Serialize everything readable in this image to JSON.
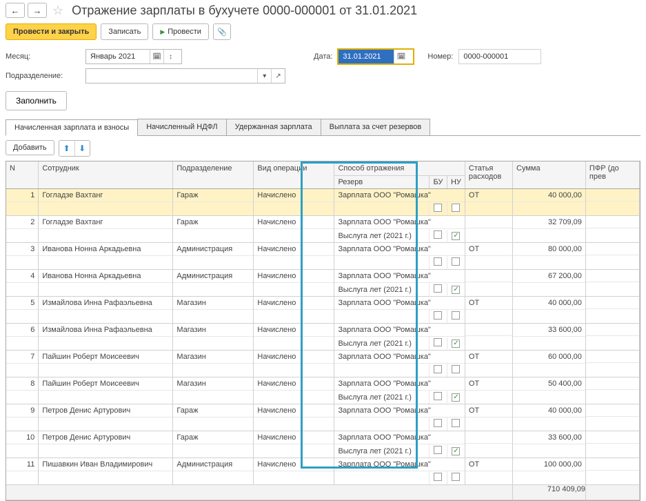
{
  "header": {
    "title": "Отражение зарплаты в бухучете 0000-000001 от 31.01.2021"
  },
  "toolbar": {
    "post_close": "Провести и закрыть",
    "save": "Записать",
    "post": "Провести"
  },
  "form": {
    "month_label": "Месяц:",
    "month_value": "Январь 2021",
    "date_label": "Дата:",
    "date_value": "31.01.2021",
    "number_label": "Номер:",
    "number_value": "0000-000001",
    "dept_label": "Подразделение:",
    "dept_value": ""
  },
  "fill_btn": "Заполнить",
  "tabs": {
    "a": "Начисленная зарплата и взносы",
    "b": "Начисленный НДФЛ",
    "c": "Удержанная зарплата",
    "d": "Выплата за счет резервов"
  },
  "table_toolbar": {
    "add": "Добавить"
  },
  "columns": {
    "n": "N",
    "emp": "Сотрудник",
    "dept": "Подразделение",
    "op": "Вид операции",
    "refl": "Способ отражения",
    "reserve": "Резерв",
    "bu": "БУ",
    "nu": "НУ",
    "cost": "Статья расходов",
    "sum": "Сумма",
    "pfr": "ПФР (до прев"
  },
  "rows": [
    {
      "n": 1,
      "emp": "Гогладзе Вахтанг",
      "dept": "Гараж",
      "op": "Начислено",
      "refl": "Зарплата ООО \"Ромашка\"",
      "reserve": "",
      "bu": false,
      "nu": false,
      "cost": "ОТ",
      "sum": "40 000,00",
      "sel": true
    },
    {
      "n": 2,
      "emp": "Гогладзе Вахтанг",
      "dept": "Гараж",
      "op": "Начислено",
      "refl": "Зарплата ООО \"Ромашка\"",
      "reserve": "Выслуга лет (2021 г.)",
      "bu": false,
      "nu": true,
      "cost": "",
      "sum": "32 709,09"
    },
    {
      "n": 3,
      "emp": "Иванова Нонна Аркадьевна",
      "dept": "Администрация",
      "op": "Начислено",
      "refl": "Зарплата ООО \"Ромашка\"",
      "reserve": "",
      "bu": false,
      "nu": false,
      "cost": "ОТ",
      "sum": "80 000,00"
    },
    {
      "n": 4,
      "emp": "Иванова Нонна Аркадьевна",
      "dept": "Администрация",
      "op": "Начислено",
      "refl": "Зарплата ООО \"Ромашка\"",
      "reserve": "Выслуга лет (2021 г.)",
      "bu": false,
      "nu": true,
      "cost": "",
      "sum": "67 200,00"
    },
    {
      "n": 5,
      "emp": "Измайлова Инна Рафаэльевна",
      "dept": "Магазин",
      "op": "Начислено",
      "refl": "Зарплата ООО \"Ромашка\"",
      "reserve": "",
      "bu": false,
      "nu": false,
      "cost": "ОТ",
      "sum": "40 000,00"
    },
    {
      "n": 6,
      "emp": "Измайлова Инна Рафаэльевна",
      "dept": "Магазин",
      "op": "Начислено",
      "refl": "Зарплата ООО \"Ромашка\"",
      "reserve": "Выслуга лет (2021 г.)",
      "bu": false,
      "nu": true,
      "cost": "",
      "sum": "33 600,00"
    },
    {
      "n": 7,
      "emp": "Пайшин Роберт Моисеевич",
      "dept": "Магазин",
      "op": "Начислено",
      "refl": "Зарплата ООО \"Ромашка\"",
      "reserve": "",
      "bu": false,
      "nu": false,
      "cost": "ОТ",
      "sum": "60 000,00"
    },
    {
      "n": 8,
      "emp": "Пайшин Роберт Моисеевич",
      "dept": "Магазин",
      "op": "Начислено",
      "refl": "Зарплата ООО \"Ромашка\"",
      "reserve": "Выслуга лет (2021 г.)",
      "bu": false,
      "nu": true,
      "cost": "ОТ",
      "sum": "50 400,00"
    },
    {
      "n": 9,
      "emp": "Петров Денис Артурович",
      "dept": "Гараж",
      "op": "Начислено",
      "refl": "Зарплата ООО \"Ромашка\"",
      "reserve": "",
      "bu": false,
      "nu": false,
      "cost": "ОТ",
      "sum": "40 000,00"
    },
    {
      "n": 10,
      "emp": "Петров Денис Артурович",
      "dept": "Гараж",
      "op": "Начислено",
      "refl": "Зарплата ООО \"Ромашка\"",
      "reserve": "Выслуга лет (2021 г.)",
      "bu": false,
      "nu": true,
      "cost": "",
      "sum": "33 600,00"
    },
    {
      "n": 11,
      "emp": "Пишавкин Иван Владимирович",
      "dept": "Администрация",
      "op": "Начислено",
      "refl": "Зарплата ООО \"Ромашка\"",
      "reserve": "",
      "bu": false,
      "nu": false,
      "cost": "ОТ",
      "sum": "100 000,00"
    }
  ],
  "footer": {
    "total_sum": "710 409,09"
  }
}
